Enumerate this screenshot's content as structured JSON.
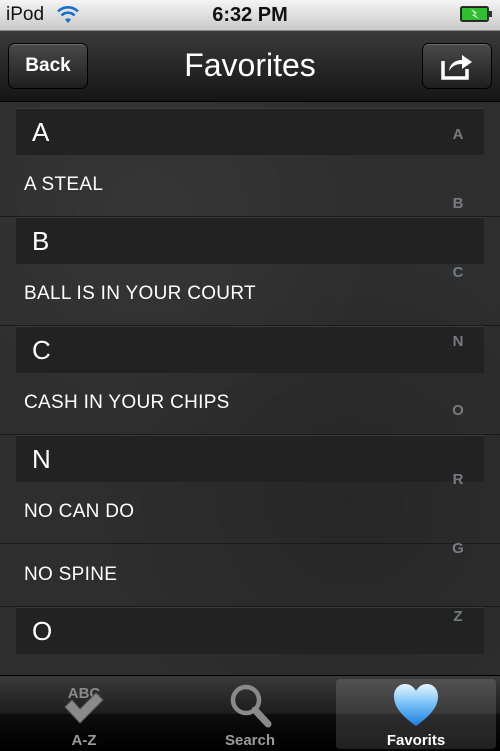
{
  "status_bar": {
    "carrier": "iPod",
    "time": "6:32 PM"
  },
  "nav": {
    "back_label": "Back",
    "title": "Favorites"
  },
  "sections": [
    {
      "letter": "A",
      "items": [
        "A STEAL"
      ]
    },
    {
      "letter": "B",
      "items": [
        "BALL IS IN YOUR COURT"
      ]
    },
    {
      "letter": "C",
      "items": [
        "CASH IN YOUR CHIPS"
      ]
    },
    {
      "letter": "N",
      "items": [
        "NO CAN DO",
        "NO SPINE"
      ]
    },
    {
      "letter": "O",
      "items": []
    }
  ],
  "index_letters": [
    "A",
    "B",
    "C",
    "N",
    "O",
    "R",
    "G",
    "Z"
  ],
  "tabs": [
    {
      "label": "A-Z",
      "icon": "abc-check-icon"
    },
    {
      "label": "Search",
      "icon": "magnifier-icon"
    },
    {
      "label": "Favorits",
      "icon": "heart-icon",
      "selected": true
    }
  ],
  "colors": {
    "accent_heart": "#3aa0e8",
    "battery": "#2fbf2f"
  }
}
